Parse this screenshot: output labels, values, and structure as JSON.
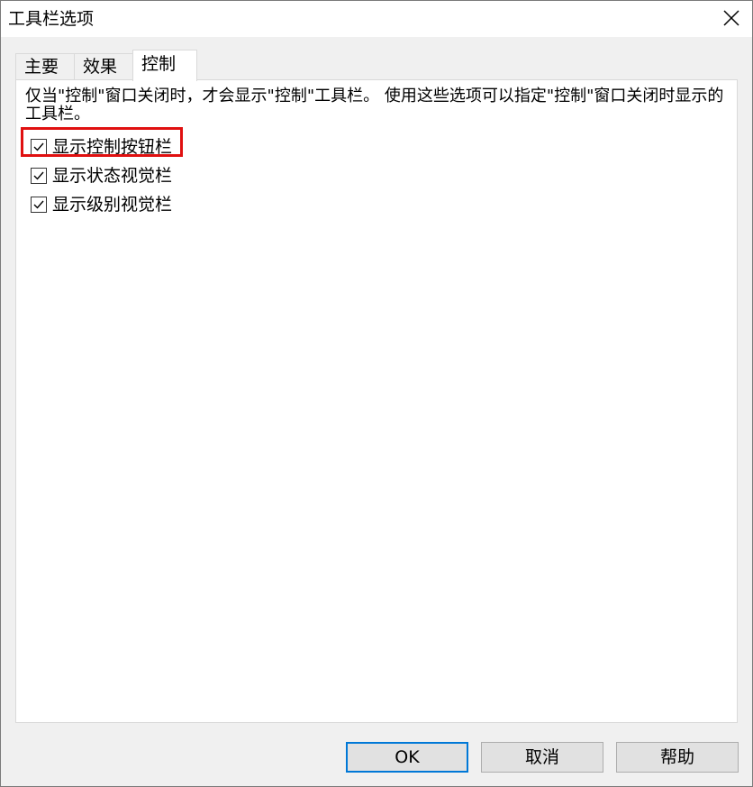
{
  "window": {
    "title": "工具栏选项"
  },
  "tabs": [
    {
      "label": "主要"
    },
    {
      "label": "效果"
    },
    {
      "label": "控制"
    }
  ],
  "panel": {
    "description": "仅当\"控制\"窗口关闭时，才会显示\"控制\"工具栏。 使用这些选项可以指定\"控制\"窗口关闭时显示的工具栏。",
    "options": [
      {
        "label": "显示控制按钮栏",
        "checked": true
      },
      {
        "label": "显示状态视觉栏",
        "checked": true
      },
      {
        "label": "显示级别视觉栏",
        "checked": true
      }
    ]
  },
  "buttons": {
    "ok": "OK",
    "cancel": "取消",
    "help": "帮助"
  },
  "colors": {
    "highlight": "#e01010",
    "default_button_border": "#0078d7"
  },
  "icons": {
    "close": "close-icon",
    "checkbox": "checkmark-icon"
  }
}
